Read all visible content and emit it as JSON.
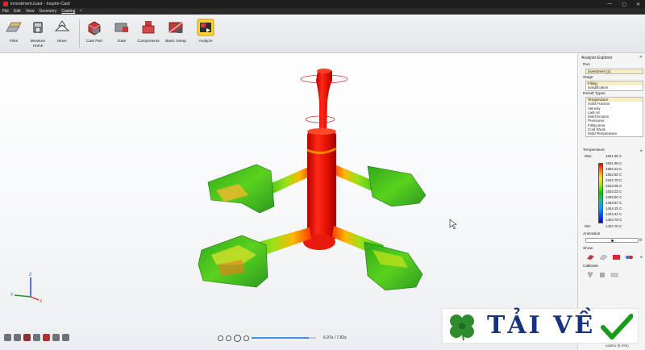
{
  "window": {
    "title": "investment.icast - Inspire Cast",
    "minimize": "—",
    "maximize": "▢",
    "close": "✕"
  },
  "menu": [
    {
      "label": "File"
    },
    {
      "label": "Edit"
    },
    {
      "label": "View"
    },
    {
      "label": "Geometry"
    },
    {
      "label": "Casting",
      "active": true
    }
  ],
  "ribbon": {
    "buttons": [
      {
        "id": "files",
        "label": "Files",
        "icon": "folder-icon"
      },
      {
        "id": "measure",
        "label": "Measure\nHome",
        "icon": "measure-icon"
      },
      {
        "id": "move",
        "label": "Move",
        "icon": "move-icon"
      },
      {
        "id": "cast-part",
        "label": "Cast Part",
        "icon": "cast-part-icon"
      },
      {
        "id": "gate",
        "label": "Gate",
        "icon": "gate-icon"
      },
      {
        "id": "components",
        "label": "Components",
        "icon": "components-icon"
      },
      {
        "id": "basic-setup",
        "label": "Basic Setup",
        "icon": "basic-setup-icon"
      },
      {
        "id": "analyze",
        "label": "Analyze",
        "icon": "analyze-icon"
      }
    ]
  },
  "explorer": {
    "title": "Analysis Explorer",
    "run_label": "Run",
    "run_value": "investment (1)",
    "stage_label": "Stage",
    "stages": [
      {
        "label": "Filling",
        "selected": true
      },
      {
        "label": "Solidification"
      }
    ],
    "result_types_label": "Result Types",
    "result_types": [
      {
        "label": "Temperature",
        "selected": true
      },
      {
        "label": "Solid Fraction"
      },
      {
        "label": "Velocity"
      },
      {
        "label": "Last Air"
      },
      {
        "label": "Mold Erosion"
      },
      {
        "label": "Pressures"
      },
      {
        "label": "Filling time"
      },
      {
        "label": "Cold Shuts"
      },
      {
        "label": "Mold Temperature"
      }
    ],
    "legend": {
      "title": "Temperature",
      "max_label": "Max:",
      "min_label": "Min:",
      "max_value": "1601.95 C",
      "min_value": "1404.78 C",
      "values": [
        "1601.95 C",
        "1582.23 C",
        "1562.50 C",
        "1542.78 C",
        "1523.05 C",
        "1503.33 C",
        "1483.60 C",
        "1463.87 C",
        "1444.15 C",
        "1424.42 C",
        "1404.78 C"
      ]
    },
    "animation_label": "Animation",
    "animation_position": 0.5,
    "show_label": "Show",
    "calibrate_label": "Calibrate",
    "colors": {
      "selected_row": "#f6efc5"
    }
  },
  "playback": {
    "time": "6.97s / 7.82s",
    "position": 0.89
  },
  "status": {
    "unit": "castno (5 mm)"
  },
  "watermark": {
    "text": "TẢI VỀ",
    "logo": "clover-icon",
    "check": "checkmark-icon",
    "colors": {
      "text": "#18337e",
      "logo": "#2e8b2e",
      "check": "#1a9a1a"
    }
  }
}
